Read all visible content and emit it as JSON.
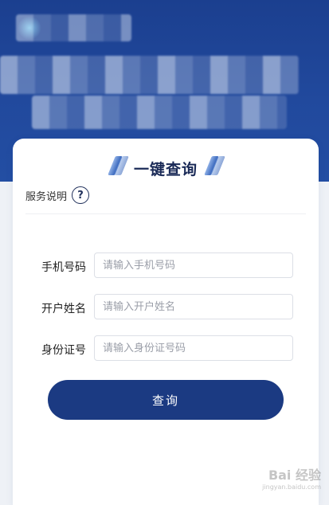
{
  "card": {
    "title": "一键查询"
  },
  "service": {
    "label": "服务说明",
    "help_glyph": "?"
  },
  "form": {
    "phone": {
      "label": "手机号码",
      "placeholder": "请输入手机号码"
    },
    "name": {
      "label": "开户姓名",
      "placeholder": "请输入开户姓名"
    },
    "id": {
      "label": "身份证号",
      "placeholder": "请输入身份证号码"
    }
  },
  "submit": {
    "label": "查询"
  },
  "watermark": {
    "brand": "Bai 经验",
    "url": "jingyan.baidu.com"
  },
  "colors": {
    "banner": "#21499d",
    "button": "#1b3a82",
    "card": "#ffffff"
  }
}
